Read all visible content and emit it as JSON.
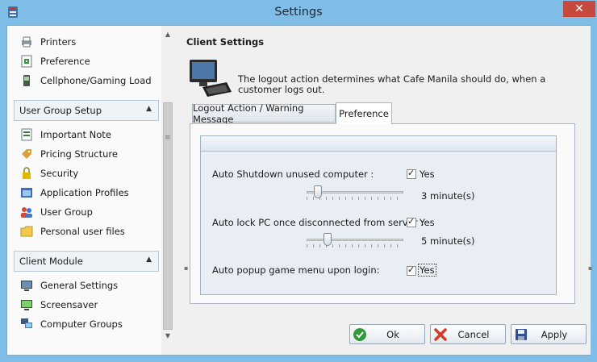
{
  "window": {
    "title": "Settings",
    "close_glyph": "✕"
  },
  "sidebar": {
    "top_items": [
      {
        "label": "Printers",
        "icon": "printer-icon"
      },
      {
        "label": "Preference",
        "icon": "preference-icon"
      },
      {
        "label": "Cellphone/Gaming Load",
        "icon": "cellphone-icon"
      }
    ],
    "groups": [
      {
        "title": "User Group Setup",
        "items": [
          {
            "label": "Important Note",
            "icon": "note-icon"
          },
          {
            "label": "Pricing Structure",
            "icon": "pricing-icon"
          },
          {
            "label": "Security",
            "icon": "lock-icon"
          },
          {
            "label": "Application Profiles",
            "icon": "app-profiles-icon"
          },
          {
            "label": "User Group",
            "icon": "users-icon"
          },
          {
            "label": "Personal user files",
            "icon": "folder-icon"
          }
        ]
      },
      {
        "title": "Client Module",
        "items": [
          {
            "label": "General Settings",
            "icon": "monitor-settings-icon"
          },
          {
            "label": "Screensaver",
            "icon": "screensaver-icon"
          },
          {
            "label": "Computer Groups",
            "icon": "computer-groups-icon"
          }
        ]
      }
    ]
  },
  "main": {
    "heading": "Client Settings",
    "description": "The logout action determines what Cafe Manila should do, when a customer logs out.",
    "tabs": [
      {
        "label": "Logout Action / Warning Message",
        "active": false
      },
      {
        "label": "Preference",
        "active": true
      }
    ],
    "options": [
      {
        "label": "Auto Shutdown unused computer :",
        "checkbox_label": "Yes",
        "checked": true,
        "slider_fraction": 0.12,
        "value_text": "3 minute(s)"
      },
      {
        "label": "Auto lock PC once disconnected from server :",
        "checkbox_label": "Yes",
        "checked": true,
        "slider_fraction": 0.22,
        "value_text": "5 minute(s)"
      },
      {
        "label": "Auto popup game menu upon login:",
        "checkbox_label": "Yes",
        "checked": true
      }
    ]
  },
  "buttons": {
    "ok": "Ok",
    "cancel": "Cancel",
    "apply": "Apply"
  },
  "colors": {
    "titlebar": "#7fbde6",
    "close": "#c7483c",
    "panel": "#e9eef4"
  }
}
